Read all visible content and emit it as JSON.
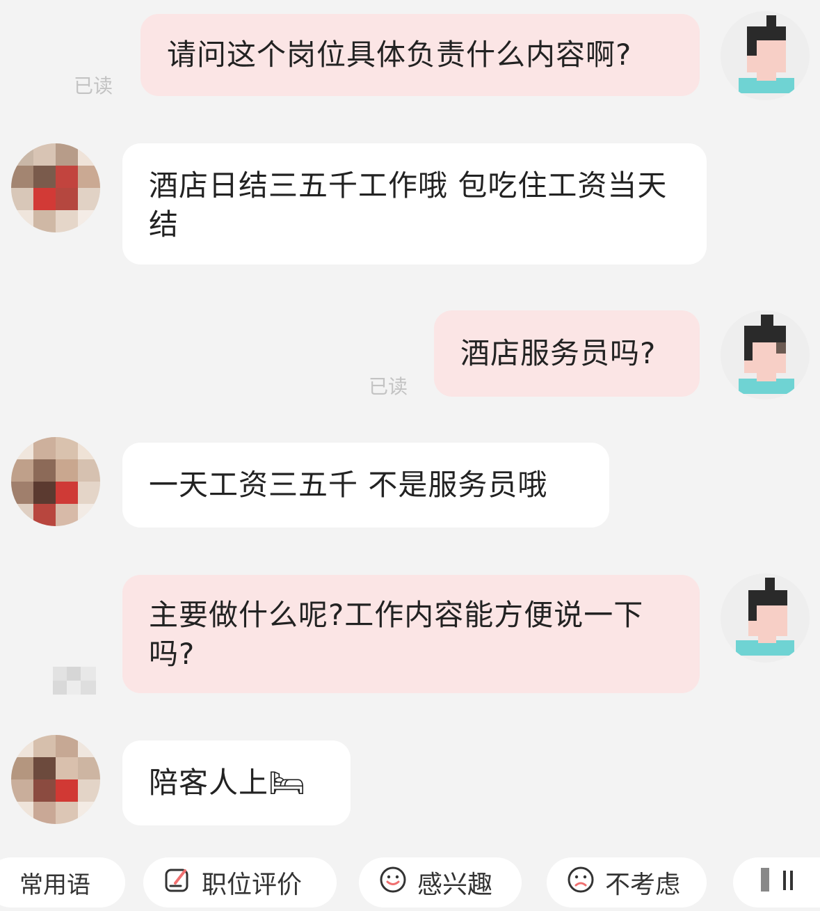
{
  "messages": [
    {
      "side": "me",
      "text": "请问这个岗位具体负责什么内容啊?",
      "status": "已读"
    },
    {
      "side": "them",
      "text": "酒店日结三五千工作哦 包吃住工资当天结"
    },
    {
      "side": "me",
      "text": "酒店服务员吗?",
      "status": "已读"
    },
    {
      "side": "them",
      "text": "一天工资三五千 不是服务员哦"
    },
    {
      "side": "me",
      "text": "主要做什么呢?工作内容能方便说一下吗?"
    },
    {
      "side": "them",
      "text": "陪客人上🛏"
    }
  ],
  "bottom_bar": {
    "quick_reply_label": "常用语",
    "actions": [
      {
        "label": "职位评价",
        "icon": "edit-icon"
      },
      {
        "label": "感兴趣",
        "icon": "smile-icon"
      },
      {
        "label": "不考虑",
        "icon": "frown-icon"
      }
    ]
  },
  "colors": {
    "background": "#f3f3f3",
    "my_bubble": "#fbe5e5",
    "their_bubble": "#ffffff",
    "read_status": "#c3c3c3"
  }
}
